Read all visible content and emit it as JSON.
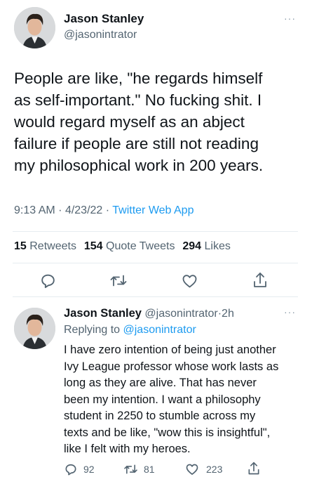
{
  "tweet": {
    "author_name": "Jason Stanley",
    "author_handle": "@jasonintrator",
    "text_lines": [
      "People are like, \"he regards himself",
      "as self-important.\" No fucking shit. I",
      "would regard myself as an abject",
      "failure if people are still not reading",
      "my philosophical work in 200 years."
    ],
    "time": "9:13 AM",
    "sep": "·",
    "date": "4/23/22",
    "source": "Twitter Web App",
    "stats": {
      "retweets_count": "15",
      "retweets_label": "Retweets",
      "quotes_count": "154",
      "quotes_label": "Quote Tweets",
      "likes_count": "294",
      "likes_label": "Likes"
    },
    "more_glyph": "···"
  },
  "reply": {
    "author_name": "Jason Stanley",
    "author_handle": "@jasonintrator",
    "sep": "·",
    "age": "2h",
    "replying_prefix": "Replying to",
    "replying_handle": "@jasonintrator",
    "text_lines": [
      "I have zero intention of being just another",
      "Ivy League professor whose work lasts as",
      "long as they are alive. That has never",
      "been my intention. I want a philosophy",
      "student in 2250 to stumble across my",
      "texts and be like, \"wow this is insightful\",",
      "like I felt with my heroes."
    ],
    "actions": {
      "reply_count": "92",
      "retweet_count": "81",
      "like_count": "223"
    },
    "more_glyph": "···"
  },
  "icons": [
    "reply-icon",
    "retweet-icon",
    "like-icon",
    "share-icon",
    "more-icon"
  ],
  "colors": {
    "text": "#0f1419",
    "muted": "#536471",
    "link": "#1d9bf0",
    "divider": "#e6ecf0"
  }
}
